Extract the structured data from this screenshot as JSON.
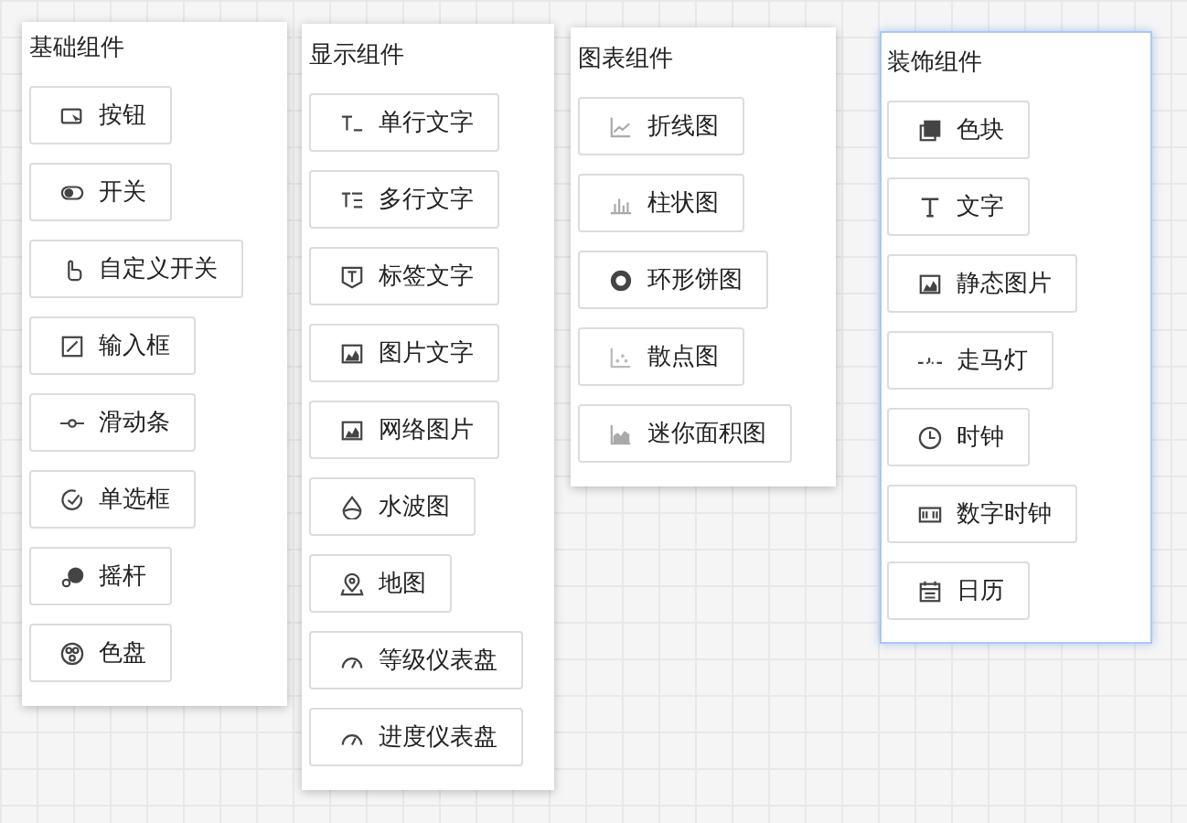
{
  "panels": [
    {
      "title": "基础组件",
      "selected": false,
      "items": [
        "按钮",
        "开关",
        "自定义开关",
        "输入框",
        "滑动条",
        "单选框",
        "摇杆",
        "色盘"
      ]
    },
    {
      "title": "显示组件",
      "selected": false,
      "items": [
        "单行文字",
        "多行文字",
        "标签文字",
        "图片文字",
        "网络图片",
        "水波图",
        "地图",
        "等级仪表盘",
        "进度仪表盘"
      ]
    },
    {
      "title": "图表组件",
      "selected": false,
      "items": [
        "折线图",
        "柱状图",
        "环形饼图",
        "散点图",
        "迷你面积图"
      ]
    },
    {
      "title": "装饰组件",
      "selected": true,
      "items": [
        "色块",
        "文字",
        "静态图片",
        "走马灯",
        "时钟",
        "数字时钟",
        "日历"
      ]
    }
  ]
}
